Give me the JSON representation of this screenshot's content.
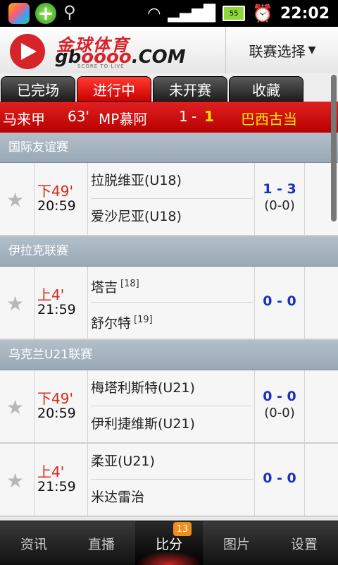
{
  "statusbar": {
    "battery": "55",
    "time": "22:02"
  },
  "header": {
    "logo_cn": "金球体育",
    "logo_en_prefix": "gb",
    "logo_en_accent": "oooo",
    "logo_en_suffix": ".COM",
    "logo_tagline": "SCORE TO LIVE",
    "league_select": "联赛选择"
  },
  "tabs": [
    {
      "label": "已完场"
    },
    {
      "label": "进行中"
    },
    {
      "label": "未开赛"
    },
    {
      "label": "收藏"
    }
  ],
  "ticker": {
    "league": "马来甲",
    "minute": "63'",
    "home": "MP慕阿",
    "home_score": "1",
    "separator": "-",
    "away_score": "1",
    "away": "巴西古当"
  },
  "groups": [
    {
      "league": "国际友谊赛",
      "matches": [
        {
          "status": "下49'",
          "kickoff": "20:59",
          "home": "拉脱维亚(U18)",
          "away": "爱沙尼亚(U18)",
          "score": "1 - 3",
          "halftime": "(0-0)"
        }
      ]
    },
    {
      "league": "伊拉克联赛",
      "matches": [
        {
          "status": "上4'",
          "kickoff": "21:59",
          "home": "塔吉",
          "home_rank": "[18]",
          "away": "舒尔特",
          "away_rank": "[19]",
          "score": "0 - 0"
        }
      ]
    },
    {
      "league": "乌克兰U21联赛",
      "matches": [
        {
          "status": "下49'",
          "kickoff": "20:59",
          "home": "梅塔利斯特(U21)",
          "away": "伊利捷维斯(U21)",
          "score": "0 - 0",
          "halftime": "(0-0)"
        },
        {
          "status": "上4'",
          "kickoff": "21:59",
          "home": "柔亚(U21)",
          "away": "米达雷治",
          "score": "0 - 0"
        }
      ]
    }
  ],
  "bottom_nav": [
    {
      "label": "资讯"
    },
    {
      "label": "直播"
    },
    {
      "label": "比分",
      "badge": "13"
    },
    {
      "label": "图片"
    },
    {
      "label": "设置"
    }
  ]
}
